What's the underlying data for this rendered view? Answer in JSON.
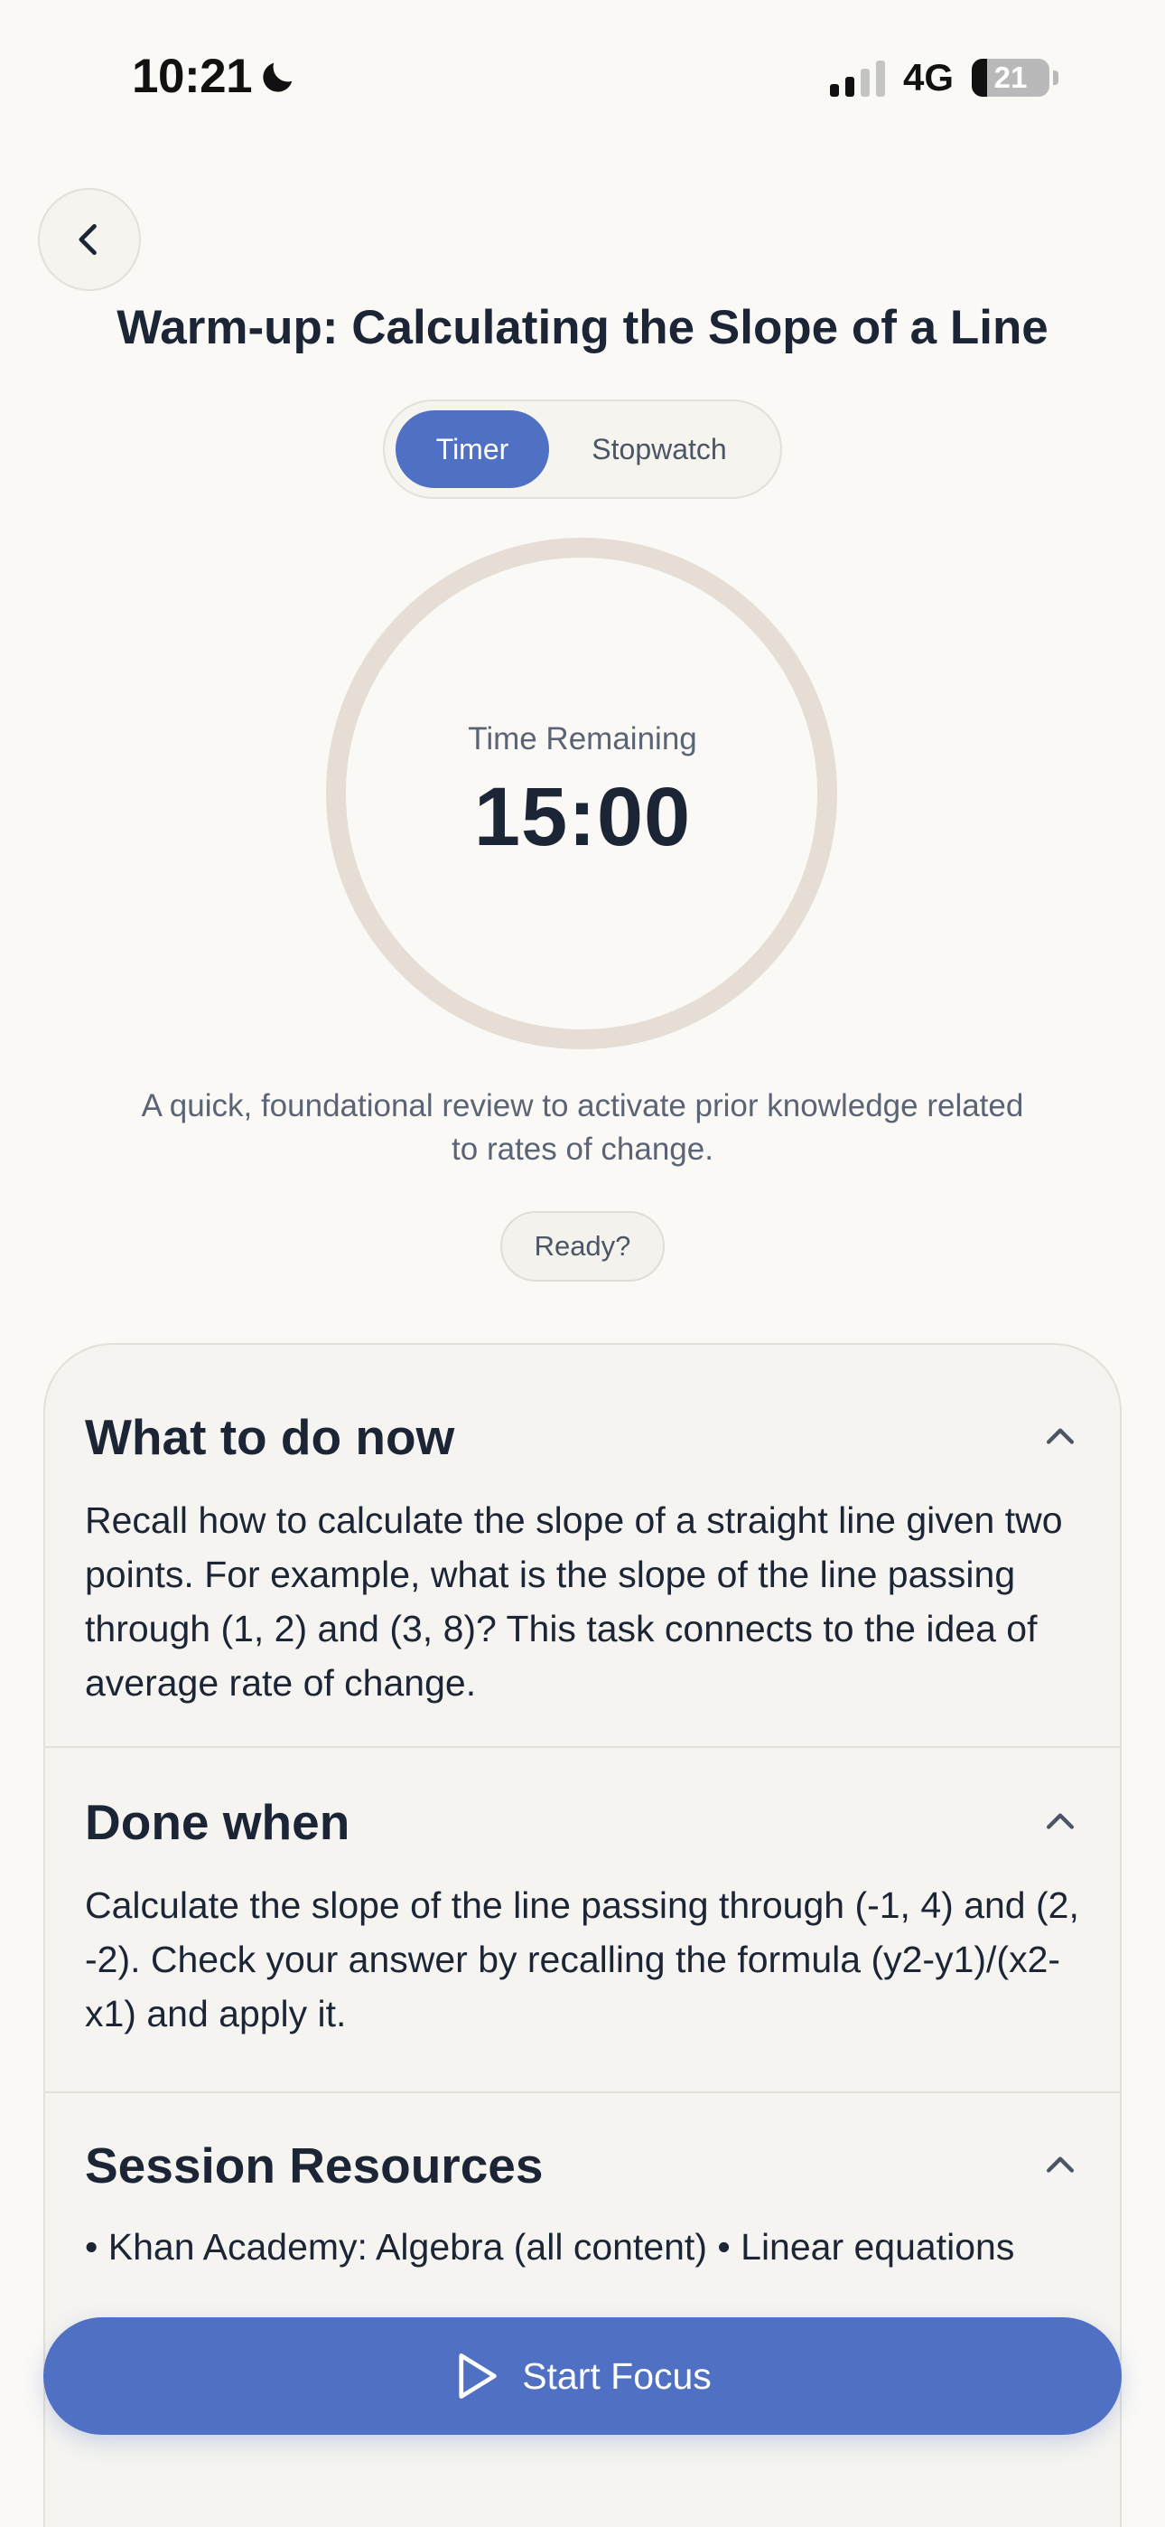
{
  "status_bar": {
    "time": "10:21",
    "network": "4G",
    "battery": "21"
  },
  "header": {
    "back_icon": "chevron-left-icon",
    "title": "Warm-up: Calculating the Slope of a Line"
  },
  "mode_toggle": {
    "options": [
      "Timer",
      "Stopwatch"
    ],
    "selected": "Timer"
  },
  "timer": {
    "label": "Time Remaining",
    "value": "15:00"
  },
  "description": "A quick, foundational review to activate prior knowledge related to rates of change.",
  "ready_label": "Ready?",
  "sections": [
    {
      "title": "What to do now",
      "body": "Recall how to calculate the slope of a straight line given two points. For example, what is the slope of the line passing through (1, 2) and (3, 8)? This task connects to the idea of average rate of change."
    },
    {
      "title": "Done when",
      "body": "Calculate the slope of the line passing through (-1, 4) and (2, -2). Check your answer by recalling the formula (y2-y1)/(x2-x1) and apply it."
    },
    {
      "title": "Session Resources",
      "items": [
        "Khan Academy: Algebra (all content)",
        "Linear equations"
      ]
    }
  ],
  "start_button": {
    "label": "Start Focus",
    "icon": "play-icon"
  },
  "colors": {
    "accent": "#5071c3",
    "background": "#faf9f6",
    "ring": "#e6ded4"
  }
}
